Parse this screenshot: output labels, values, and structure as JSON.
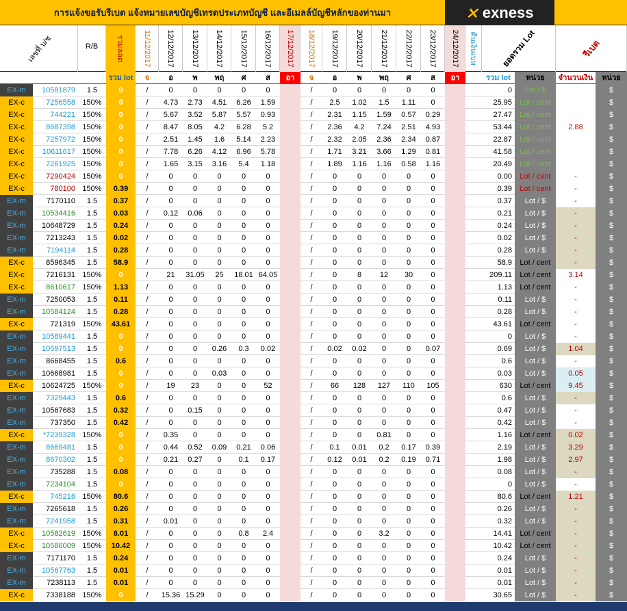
{
  "title": "การแจ้งขอรับรีเบต  แจ้งหมายเลขบัญชีเทรดประเภทบัญชี และอีเมลล์บัญชีหลักของท่านมา",
  "logo_text": "exness",
  "headers": {
    "account_no": "เลขที่ บ/ช",
    "rb": "R/B",
    "total_lot": "รวมลอต",
    "dates": [
      "11/12/2017",
      "12/12/2017",
      "13/12/2017",
      "14/12/2017",
      "15/12/2017",
      "16/12/2017",
      "17/12/2017",
      "18/12/2017",
      "19/12/2017",
      "20/12/2017",
      "21/12/2017",
      "22/12/2017",
      "23/12/2017",
      "24/12/2017"
    ],
    "refund": "คืนเงินเบท",
    "sum_lot": "ยอดรวม Lot",
    "rebate": "รีเบต"
  },
  "subheaders": {
    "sum_lot": "รวม lot",
    "days": [
      "จ",
      "อ",
      "พ",
      "พฤ",
      "ศ",
      "ส",
      "อา",
      "จ",
      "อ",
      "พ",
      "พฤ",
      "ศ",
      "ส",
      "อา"
    ],
    "sum_lot2": "รวม lot",
    "unit": "หน่วย",
    "amount": "จำนวนเงิน",
    "unit2": "หน่วย"
  },
  "rows": [
    {
      "type": "EX-m",
      "acc": "10581879",
      "rb": "1.5",
      "lot": "0",
      "d": [
        "/",
        "0",
        "0",
        "0",
        "0",
        "0",
        "/",
        "0",
        "0",
        "0",
        "0",
        "0"
      ],
      "total": "0",
      "unit": "Lot / $",
      "rebate": "",
      "cur": "$"
    },
    {
      "type": "EX-c",
      "acc": "7256558",
      "rb": "150%",
      "lot": "0",
      "d": [
        "/",
        "4.73",
        "2.73",
        "4.51",
        "6.26",
        "1.59",
        "/",
        "2.5",
        "1.02",
        "1.5",
        "1.11",
        "0"
      ],
      "total": "25.95",
      "unit": "Lot / cent",
      "rebate": "",
      "cur": "$"
    },
    {
      "type": "EX-c",
      "acc": "744221",
      "rb": "150%",
      "lot": "0",
      "d": [
        "/",
        "5.67",
        "3.52",
        "5.87",
        "5.57",
        "0.93",
        "/",
        "2.31",
        "1.15",
        "1.59",
        "0.57",
        "0.29"
      ],
      "total": "27.47",
      "unit": "Lot / cent",
      "rebate": "",
      "cur": "$"
    },
    {
      "type": "EX-c",
      "acc": "8687398",
      "rb": "150%",
      "lot": "0",
      "d": [
        "/",
        "8.47",
        "8.05",
        "4.2",
        "6.28",
        "5.2",
        "/",
        "2.36",
        "4.2",
        "7.24",
        "2.51",
        "4.93"
      ],
      "total": "53.44",
      "unit": "Lot / cent",
      "rebate": "2.88",
      "cur": "$"
    },
    {
      "type": "EX-c",
      "acc": "7257972",
      "rb": "150%",
      "lot": "0",
      "d": [
        "/",
        "2.51",
        "1.45",
        "1.6",
        "5.14",
        "2.23",
        "/",
        "2.32",
        "2.05",
        "2.36",
        "2.34",
        "0.87"
      ],
      "total": "22.87",
      "unit": "Lot / cent",
      "rebate": "",
      "cur": "$"
    },
    {
      "type": "EX-c",
      "acc": "10611617",
      "rb": "150%",
      "lot": "0",
      "d": [
        "/",
        "7.78",
        "6.26",
        "4.12",
        "6.96",
        "5.78",
        "/",
        "1.71",
        "3.21",
        "3.66",
        "1.29",
        "0.81"
      ],
      "total": "41.58",
      "unit": "Lot / cent",
      "rebate": "",
      "cur": "$"
    },
    {
      "type": "EX-c",
      "acc": "7261925",
      "rb": "150%",
      "lot": "0",
      "d": [
        "/",
        "1.65",
        "3.15",
        "3.16",
        "5.4",
        "1.18",
        "/",
        "1.89",
        "1.16",
        "1.16",
        "0.58",
        "1.16"
      ],
      "total": "20.49",
      "unit": "Lot / cent",
      "rebate": "",
      "cur": "$"
    },
    {
      "type": "EX-c",
      "acc": "7290424",
      "rb": "150%",
      "lot": "0",
      "d": [
        "/",
        "0",
        "0",
        "0",
        "0",
        "0",
        "/",
        "0",
        "0",
        "0",
        "0",
        "0"
      ],
      "total": "0.00",
      "unit": "Lot / cent",
      "rebate": "-",
      "cur": "$"
    },
    {
      "type": "EX-c",
      "acc": "780100",
      "rb": "150%",
      "lot": "0.39",
      "d": [
        "/",
        "0",
        "0",
        "0",
        "0",
        "0",
        "/",
        "0",
        "0",
        "0",
        "0",
        "0"
      ],
      "total": "0.39",
      "unit": "Lot / cent",
      "rebate": "-",
      "cur": "$"
    },
    {
      "type": "EX-m",
      "acc": "7170110",
      "rb": "1.5",
      "lot": "0.37",
      "d": [
        "/",
        "0",
        "0",
        "0",
        "0",
        "0",
        "/",
        "0",
        "0",
        "0",
        "0",
        "0"
      ],
      "total": "0.37",
      "unit": "Lot / $",
      "rebate": "-",
      "cur": "$"
    },
    {
      "type": "EX-m",
      "acc": "10534416",
      "rb": "1.5",
      "lot": "0.03",
      "d": [
        "/",
        "0.12",
        "0.06",
        "0",
        "0",
        "0",
        "/",
        "0",
        "0",
        "0",
        "0",
        "0"
      ],
      "total": "0.21",
      "unit": "Lot / $",
      "rebate": "-",
      "cur": "$"
    },
    {
      "type": "EX-m",
      "acc": "10648729",
      "rb": "1.5",
      "lot": "0.24",
      "d": [
        "/",
        "0",
        "0",
        "0",
        "0",
        "0",
        "/",
        "0",
        "0",
        "0",
        "0",
        "0"
      ],
      "total": "0.24",
      "unit": "Lot / $",
      "rebate": "-",
      "cur": "$"
    },
    {
      "type": "EX-m",
      "acc": "7213243",
      "rb": "1.5",
      "lot": "0.02",
      "d": [
        "/",
        "0",
        "0",
        "0",
        "0",
        "0",
        "/",
        "0",
        "0",
        "0",
        "0",
        "0"
      ],
      "total": "0.02",
      "unit": "Lot / $",
      "rebate": "-",
      "cur": "$"
    },
    {
      "type": "EX-m",
      "acc": "7194114",
      "rb": "1.5",
      "lot": "0.28",
      "d": [
        "/",
        "0",
        "0",
        "0",
        "0",
        "0",
        "/",
        "0",
        "0",
        "0",
        "0",
        "0"
      ],
      "total": "0.28",
      "unit": "Lot / $",
      "rebate": "-",
      "cur": "$"
    },
    {
      "type": "EX-c",
      "acc": "8596345",
      "rb": "1.5",
      "lot": "58.9",
      "d": [
        "/",
        "0",
        "0",
        "0",
        "0",
        "0",
        "/",
        "0",
        "0",
        "0",
        "0",
        "0"
      ],
      "total": "58.9",
      "unit": "Lot / cent",
      "rebate": "-",
      "cur": "$"
    },
    {
      "type": "EX-c",
      "acc": "7216131",
      "rb": "150%",
      "lot": "0",
      "d": [
        "/",
        "21",
        "31.05",
        "25",
        "18.01",
        "64.05",
        "/",
        "0",
        "8",
        "12",
        "30",
        "0"
      ],
      "total": "209.11",
      "unit": "Lot / cent",
      "rebate": "3.14",
      "cur": "$"
    },
    {
      "type": "EX-c",
      "acc": "8610617",
      "rb": "150%",
      "lot": "1.13",
      "d": [
        "/",
        "0",
        "0",
        "0",
        "0",
        "0",
        "/",
        "0",
        "0",
        "0",
        "0",
        "0"
      ],
      "total": "1.13",
      "unit": "Lot / cent",
      "rebate": "-",
      "cur": "$"
    },
    {
      "type": "EX-m",
      "acc": "7250053",
      "rb": "1.5",
      "lot": "0.11",
      "d": [
        "/",
        "0",
        "0",
        "0",
        "0",
        "0",
        "/",
        "0",
        "0",
        "0",
        "0",
        "0"
      ],
      "total": "0.11",
      "unit": "Lot / $",
      "rebate": "-",
      "cur": "$"
    },
    {
      "type": "EX-m",
      "acc": "10584124",
      "rb": "1.5",
      "lot": "0.28",
      "d": [
        "/",
        "0",
        "0",
        "0",
        "0",
        "0",
        "/",
        "0",
        "0",
        "0",
        "0",
        "0"
      ],
      "total": "0.28",
      "unit": "Lot / $",
      "rebate": "-",
      "cur": "$"
    },
    {
      "type": "EX-c",
      "acc": "721319",
      "rb": "150%",
      "lot": "43.61",
      "d": [
        "/",
        "0",
        "0",
        "0",
        "0",
        "0",
        "/",
        "0",
        "0",
        "0",
        "0",
        "0"
      ],
      "total": "43.61",
      "unit": "Lot / cent",
      "rebate": "-",
      "cur": "$"
    },
    {
      "type": "EX-m",
      "acc": "10589441",
      "rb": "1.5",
      "lot": "0",
      "d": [
        "/",
        "0",
        "0",
        "0",
        "0",
        "0",
        "/",
        "0",
        "0",
        "0",
        "0",
        "0"
      ],
      "total": "0",
      "unit": "Lot / $",
      "rebate": "-",
      "cur": "$"
    },
    {
      "type": "EX-m",
      "acc": "10597513",
      "rb": "1.5",
      "lot": "0",
      "d": [
        "/",
        "0",
        "0",
        "0.26",
        "0.3",
        "0.02",
        "/",
        "0.02",
        "0.02",
        "0",
        "0",
        "0.07"
      ],
      "total": "0.69",
      "unit": "Lot / $",
      "rebate": "1.04",
      "cur": "$"
    },
    {
      "type": "EX-m",
      "acc": "8668455",
      "rb": "1.5",
      "lot": "0.6",
      "d": [
        "/",
        "0",
        "0",
        "0",
        "0",
        "0",
        "/",
        "0",
        "0",
        "0",
        "0",
        "0"
      ],
      "total": "0.6",
      "unit": "Lot / $",
      "rebate": "-",
      "cur": "$"
    },
    {
      "type": "EX-m",
      "acc": "10668981",
      "rb": "1.5",
      "lot": "0",
      "d": [
        "/",
        "0",
        "0",
        "0.03",
        "0",
        "0",
        "/",
        "0",
        "0",
        "0",
        "0",
        "0"
      ],
      "total": "0.03",
      "unit": "Lot / $",
      "rebate": "0.05",
      "cur": "$"
    },
    {
      "type": "EX-c",
      "acc": "10624725",
      "rb": "150%",
      "lot": "0",
      "d": [
        "/",
        "19",
        "23",
        "0",
        "0",
        "52",
        "/",
        "66",
        "128",
        "127",
        "110",
        "105"
      ],
      "total": "630",
      "unit": "Lot / cent",
      "rebate": "9.45",
      "cur": "$"
    },
    {
      "type": "EX-m",
      "acc": "7329443",
      "rb": "1.5",
      "lot": "0.6",
      "d": [
        "/",
        "0",
        "0",
        "0",
        "0",
        "0",
        "/",
        "0",
        "0",
        "0",
        "0",
        "0"
      ],
      "total": "0.6",
      "unit": "Lot / $",
      "rebate": "-",
      "cur": "$"
    },
    {
      "type": "EX-m",
      "acc": "10567683",
      "rb": "1.5",
      "lot": "0.32",
      "d": [
        "/",
        "0",
        "0.15",
        "0",
        "0",
        "0",
        "/",
        "0",
        "0",
        "0",
        "0",
        "0"
      ],
      "total": "0.47",
      "unit": "Lot / $",
      "rebate": "-",
      "cur": "$"
    },
    {
      "type": "EX-m",
      "acc": "737350",
      "rb": "1.5",
      "lot": "0.42",
      "d": [
        "/",
        "0",
        "0",
        "0",
        "0",
        "0",
        "/",
        "0",
        "0",
        "0",
        "0",
        "0"
      ],
      "total": "0.42",
      "unit": "Lot / $",
      "rebate": "-",
      "cur": "$"
    },
    {
      "type": "EX-c",
      "acc": "*7239328",
      "rb": "150%",
      "lot": "0",
      "d": [
        "/",
        "0.35",
        "0",
        "0",
        "0",
        "0",
        "/",
        "0",
        "0",
        "0.81",
        "0",
        "0"
      ],
      "total": "1.16",
      "unit": "Lot / cent",
      "rebate": "0.02",
      "cur": "$"
    },
    {
      "type": "EX-m",
      "acc": "8669481",
      "rb": "1.5",
      "lot": "0",
      "d": [
        "/",
        "0.44",
        "0.52",
        "0.09",
        "0.21",
        "0.06",
        "/",
        "0.1",
        "0.01",
        "0.2",
        "0.17",
        "0.39"
      ],
      "total": "2.19",
      "unit": "Lot / $",
      "rebate": "3.29",
      "cur": "$"
    },
    {
      "type": "EX-m",
      "acc": "8670302",
      "rb": "1.5",
      "lot": "0",
      "d": [
        "/",
        "0.21",
        "0.27",
        "0",
        "0.1",
        "0.17",
        "/",
        "0.12",
        "0.01",
        "0.2",
        "0.19",
        "0.71"
      ],
      "total": "1.98",
      "unit": "Lot / $",
      "rebate": "2.97",
      "cur": "$"
    },
    {
      "type": "EX-m",
      "acc": "735288",
      "rb": "1.5",
      "lot": "0.08",
      "d": [
        "/",
        "0",
        "0",
        "0",
        "0",
        "0",
        "/",
        "0",
        "0",
        "0",
        "0",
        "0"
      ],
      "total": "0.08",
      "unit": "Lot / $",
      "rebate": "-",
      "cur": "$"
    },
    {
      "type": "EX-m",
      "acc": "7234104",
      "rb": "1.5",
      "lot": "0",
      "d": [
        "/",
        "0",
        "0",
        "0",
        "0",
        "0",
        "/",
        "0",
        "0",
        "0",
        "0",
        "0"
      ],
      "total": "0",
      "unit": "Lot / $",
      "rebate": "-",
      "cur": "$"
    },
    {
      "type": "EX-c",
      "acc": "745216",
      "rb": "150%",
      "lot": "80.6",
      "d": [
        "/",
        "0",
        "0",
        "0",
        "0",
        "0",
        "/",
        "0",
        "0",
        "0",
        "0",
        "0"
      ],
      "total": "80.6",
      "unit": "Lot / cent",
      "rebate": "1.21",
      "cur": "$"
    },
    {
      "type": "EX-m",
      "acc": "7265618",
      "rb": "1.5",
      "lot": "0.26",
      "d": [
        "/",
        "0",
        "0",
        "0",
        "0",
        "0",
        "/",
        "0",
        "0",
        "0",
        "0",
        "0"
      ],
      "total": "0.26",
      "unit": "Lot / $",
      "rebate": "-",
      "cur": "$"
    },
    {
      "type": "EX-m",
      "acc": "7241958",
      "rb": "1.5",
      "lot": "0.31",
      "d": [
        "/",
        "0.01",
        "0",
        "0",
        "0",
        "0",
        "/",
        "0",
        "0",
        "0",
        "0",
        "0"
      ],
      "total": "0.32",
      "unit": "Lot / $",
      "rebate": "-",
      "cur": "$"
    },
    {
      "type": "EX-c",
      "acc": "10582619",
      "rb": "150%",
      "lot": "8.01",
      "d": [
        "/",
        "0",
        "0",
        "0",
        "0.8",
        "2.4",
        "/",
        "0",
        "0",
        "3.2",
        "0",
        "0"
      ],
      "total": "14.41",
      "unit": "Lot / cent",
      "rebate": "-",
      "cur": "$"
    },
    {
      "type": "EX-c",
      "acc": "10586009",
      "rb": "150%",
      "lot": "10.42",
      "d": [
        "/",
        "0",
        "0",
        "0",
        "0",
        "0",
        "/",
        "0",
        "0",
        "0",
        "0",
        "0"
      ],
      "total": "10.42",
      "unit": "Lot / cent",
      "rebate": "-",
      "cur": "$"
    },
    {
      "type": "EX-m",
      "acc": "7171170",
      "rb": "1.5",
      "lot": "0.24",
      "d": [
        "/",
        "0",
        "0",
        "0",
        "0",
        "0",
        "/",
        "0",
        "0",
        "0",
        "0",
        "0"
      ],
      "total": "0.24",
      "unit": "Lot / $",
      "rebate": "-",
      "cur": "$"
    },
    {
      "type": "EX-m",
      "acc": "10567763",
      "rb": "1.5",
      "lot": "0.01",
      "d": [
        "/",
        "0",
        "0",
        "0",
        "0",
        "0",
        "/",
        "0",
        "0",
        "0",
        "0",
        "0"
      ],
      "total": "0.01",
      "unit": "Lot / $",
      "rebate": "-",
      "cur": "$"
    },
    {
      "type": "EX-m",
      "acc": "7238113",
      "rb": "1.5",
      "lot": "0.01",
      "d": [
        "/",
        "0",
        "0",
        "0",
        "0",
        "0",
        "/",
        "0",
        "0",
        "0",
        "0",
        "0"
      ],
      "total": "0.01",
      "unit": "Lot / $",
      "rebate": "-",
      "cur": "$"
    },
    {
      "type": "EX-c",
      "acc": "7338188",
      "rb": "150%",
      "lot": "0",
      "d": [
        "/",
        "15.36",
        "15.29",
        "0",
        "0",
        "0",
        "/",
        "0",
        "0",
        "0",
        "0",
        "0"
      ],
      "total": "30.65",
      "unit": "Lot / $",
      "rebate": "-",
      "cur": "$"
    }
  ],
  "colors": {
    "gold": "#ffc000",
    "pink": "#f5dada",
    "gray": "#808080",
    "dark": "#404040",
    "blue": "#1a9ad6",
    "red": "#c00000"
  }
}
